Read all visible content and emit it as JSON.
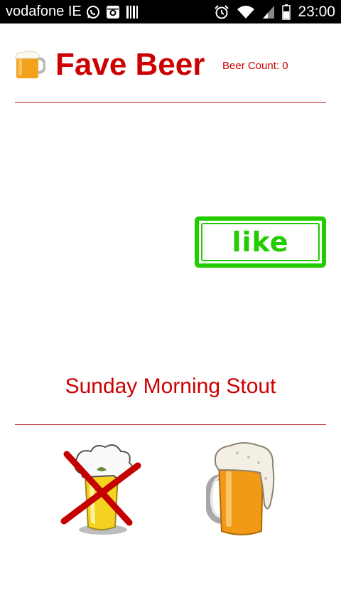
{
  "status_bar": {
    "carrier": "vodafone IE",
    "time": "23:00",
    "left_icons": [
      "whatsapp-icon",
      "instagram-icon",
      "barcode-icon"
    ],
    "right_icons": [
      "alarm-icon",
      "wifi-icon",
      "signal-icon",
      "battery-icon"
    ]
  },
  "header": {
    "title": "Fave Beer",
    "beer_count": "Beer Count: 0",
    "icon": "beer-mug-icon"
  },
  "card": {
    "stamp_label": "like",
    "beer_name": "Sunday Morning Stout"
  },
  "actions": {
    "dislike_icon": "crossed-beer-icon",
    "like_icon": "beer-mug-icon"
  },
  "colors": {
    "accent": "#cc0000",
    "like_green": "#22cc00",
    "divider": "#b71c1c",
    "status_bar": "#000000"
  }
}
